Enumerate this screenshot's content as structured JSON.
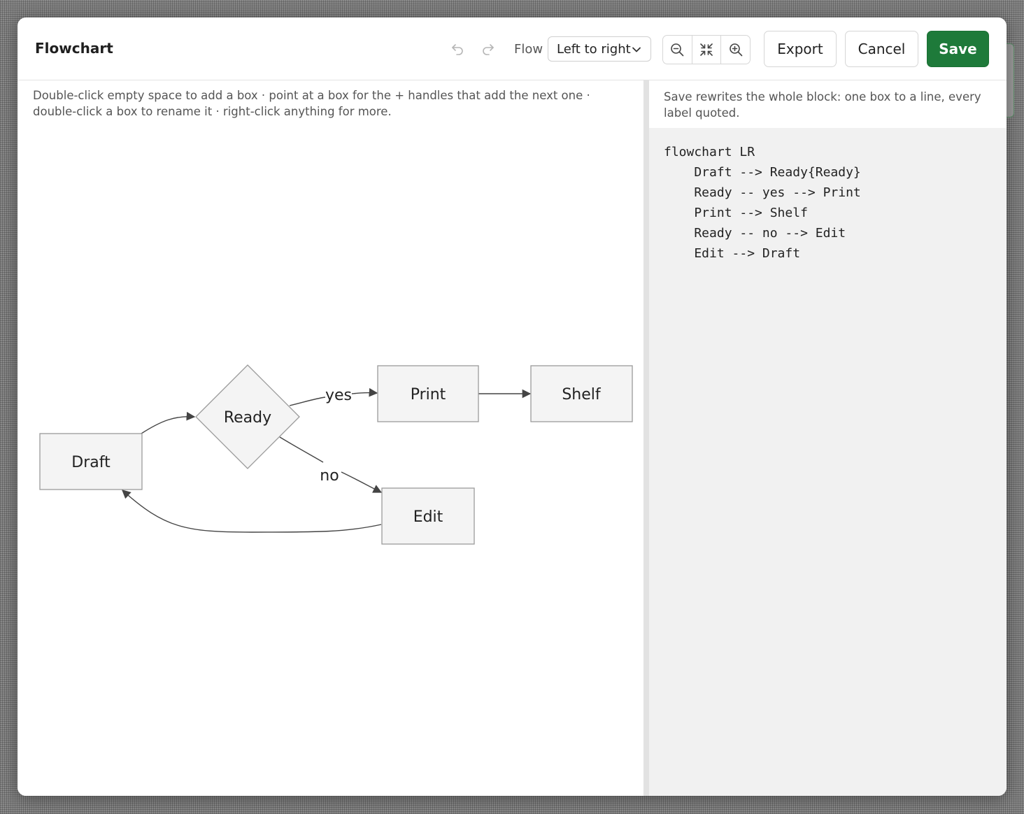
{
  "dialog": {
    "title": "Flowchart",
    "flow_label": "Flow",
    "flow_direction": "Left to right",
    "export_label": "Export",
    "cancel_label": "Cancel",
    "save_label": "Save",
    "accent_color": "#1e7a3a"
  },
  "icons": [
    "undo-icon",
    "redo-icon",
    "chevron-down-icon",
    "zoom-out-icon",
    "fit-view-icon",
    "zoom-in-icon"
  ],
  "canvas": {
    "hint": "Double-click empty space to add a box · point at a box for the + handles that add the next one · double-click a box to rename it · right-click anything for more.",
    "nodes": [
      {
        "id": "Draft",
        "label": "Draft",
        "shape": "rect"
      },
      {
        "id": "Ready",
        "label": "Ready",
        "shape": "diamond"
      },
      {
        "id": "Print",
        "label": "Print",
        "shape": "rect"
      },
      {
        "id": "Shelf",
        "label": "Shelf",
        "shape": "rect"
      },
      {
        "id": "Edit",
        "label": "Edit",
        "shape": "rect"
      }
    ],
    "edges": [
      {
        "from": "Draft",
        "to": "Ready",
        "label": ""
      },
      {
        "from": "Ready",
        "to": "Print",
        "label": "yes"
      },
      {
        "from": "Print",
        "to": "Shelf",
        "label": ""
      },
      {
        "from": "Ready",
        "to": "Edit",
        "label": "no"
      },
      {
        "from": "Edit",
        "to": "Draft",
        "label": ""
      }
    ]
  },
  "code_panel": {
    "note": "Save rewrites the whole block: one box to a line, every label quoted.",
    "code": "flowchart LR\n    Draft --> Ready{Ready}\n    Ready -- yes --> Print\n    Print --> Shelf\n    Ready -- no --> Edit\n    Edit --> Draft"
  }
}
